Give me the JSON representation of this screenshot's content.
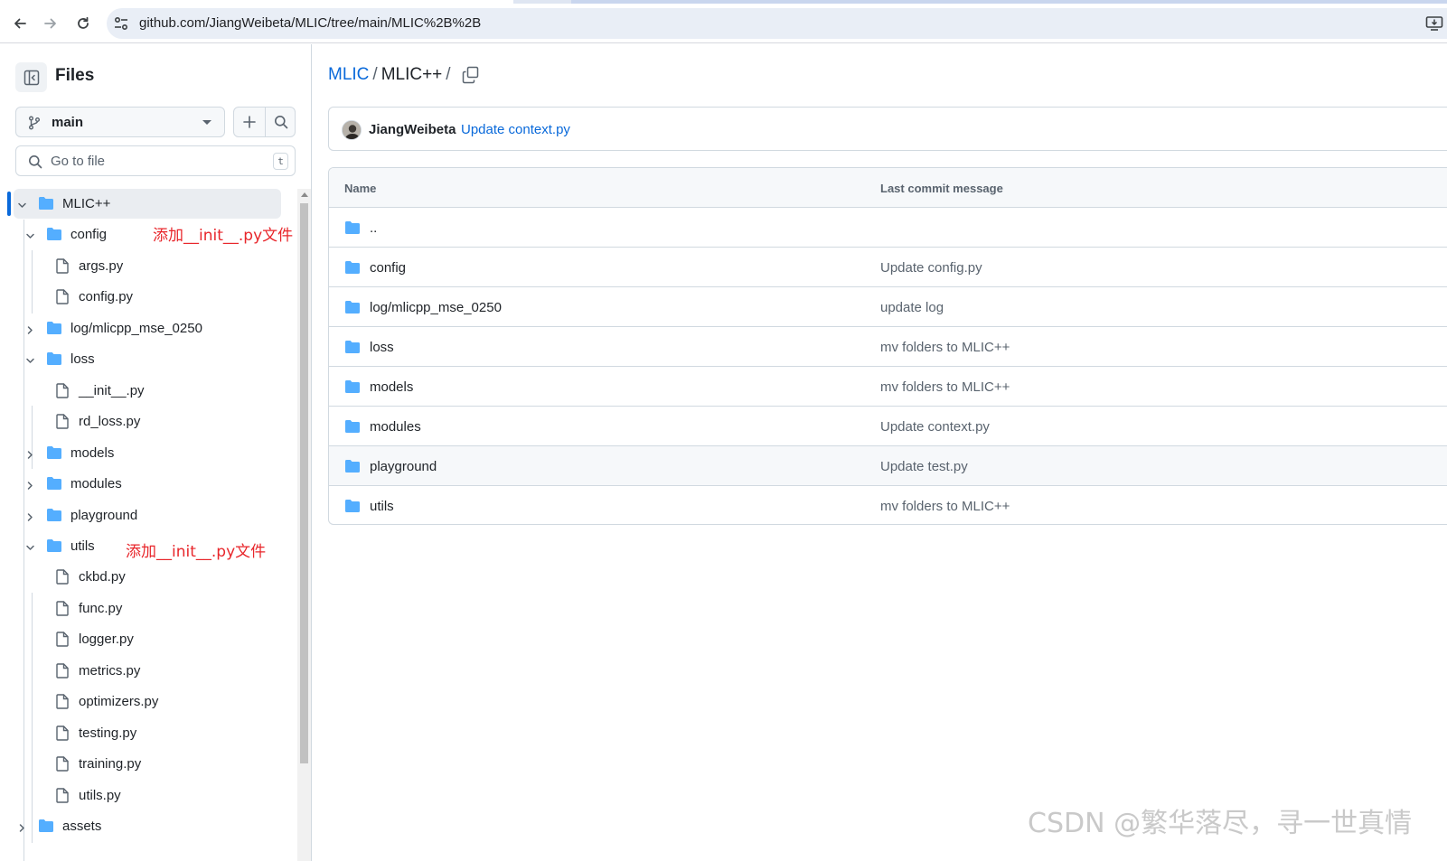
{
  "browser": {
    "url": "github.com/JiangWeibeta/MLIC/tree/main/MLIC%2B%2B"
  },
  "sidebar": {
    "title": "Files",
    "branch": "main",
    "goto_placeholder": "Go to file",
    "goto_shortcut": "t",
    "tree": [
      {
        "label": "MLIC++",
        "type": "folder",
        "level": 0,
        "expanded": true,
        "active": true
      },
      {
        "label": "config",
        "type": "folder",
        "level": 1,
        "expanded": true
      },
      {
        "label": "args.py",
        "type": "file",
        "level": 2
      },
      {
        "label": "config.py",
        "type": "file",
        "level": 2
      },
      {
        "label": "log/mlicpp_mse_0250",
        "type": "folder",
        "level": 1,
        "expanded": false
      },
      {
        "label": "loss",
        "type": "folder",
        "level": 1,
        "expanded": true
      },
      {
        "label": "__init__.py",
        "type": "file",
        "level": 2
      },
      {
        "label": "rd_loss.py",
        "type": "file",
        "level": 2
      },
      {
        "label": "models",
        "type": "folder",
        "level": 1,
        "expanded": false
      },
      {
        "label": "modules",
        "type": "folder",
        "level": 1,
        "expanded": false
      },
      {
        "label": "playground",
        "type": "folder",
        "level": 1,
        "expanded": false
      },
      {
        "label": "utils",
        "type": "folder",
        "level": 1,
        "expanded": true
      },
      {
        "label": "ckbd.py",
        "type": "file",
        "level": 2
      },
      {
        "label": "func.py",
        "type": "file",
        "level": 2
      },
      {
        "label": "logger.py",
        "type": "file",
        "level": 2
      },
      {
        "label": "metrics.py",
        "type": "file",
        "level": 2
      },
      {
        "label": "optimizers.py",
        "type": "file",
        "level": 2
      },
      {
        "label": "testing.py",
        "type": "file",
        "level": 2
      },
      {
        "label": "training.py",
        "type": "file",
        "level": 2
      },
      {
        "label": "utils.py",
        "type": "file",
        "level": 2
      },
      {
        "label": "assets",
        "type": "folder",
        "level": 0,
        "expanded": false
      }
    ],
    "annotations": [
      "添加__init__.py文件",
      "添加__init__.py文件"
    ]
  },
  "main": {
    "breadcrumb": {
      "repo": "MLIC",
      "sep": "/",
      "dir": "MLIC++",
      "trail": "/"
    },
    "commit": {
      "author": "JiangWeibeta",
      "message": "Update context.py"
    },
    "table": {
      "headers": [
        "Name",
        "Last commit message"
      ],
      "rows": [
        {
          "name": "..",
          "message": ""
        },
        {
          "name": "config",
          "message": "Update config.py"
        },
        {
          "name": "log/mlicpp_mse_0250",
          "message": "update log"
        },
        {
          "name": "loss",
          "message": "mv folders to MLIC++"
        },
        {
          "name": "models",
          "message": "mv folders to MLIC++"
        },
        {
          "name": "modules",
          "message": "Update context.py"
        },
        {
          "name": "playground",
          "message": "Update test.py"
        },
        {
          "name": "utils",
          "message": "mv folders to MLIC++"
        }
      ]
    }
  },
  "watermark": "CSDN @繁华落尽，寻一世真情",
  "colors": {
    "accent": "#0969da",
    "folder": "#54aeff",
    "annotation": "#e8262b"
  }
}
